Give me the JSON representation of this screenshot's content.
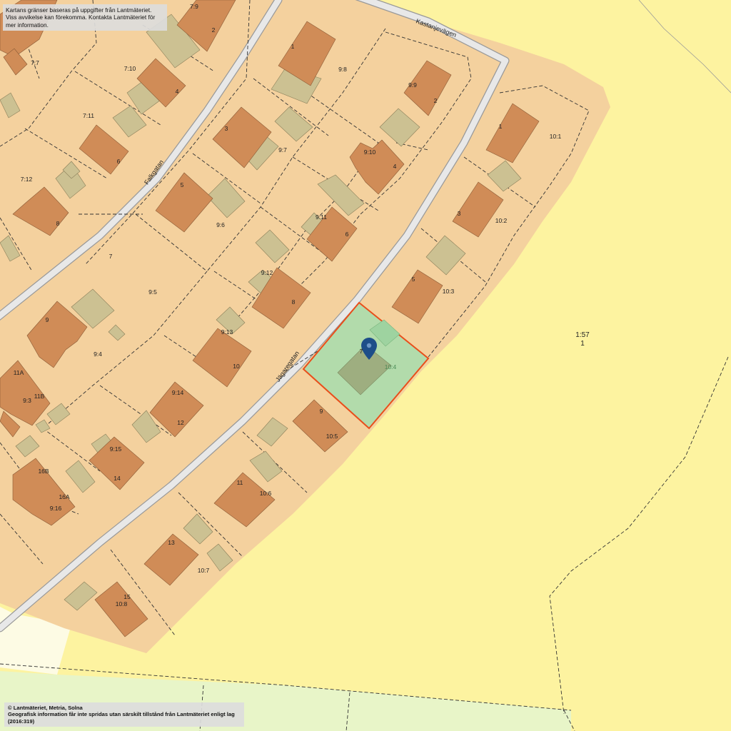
{
  "notices": {
    "top_line1": "Kartans gränser baseras på uppgifter från Lantmäteriet.",
    "top_line2": "Viss avvikelse kan förekomma. Kontakta Lantmäteriet för mer information.",
    "bottom_line1": "© Lantmäteriet, Metria, Solna",
    "bottom_line2": "Geografisk information får inte spridas utan särskilt tillstånd från Lantmäteriet enligt lag (2016:319)"
  },
  "streets": {
    "falkgatan": "Falkgatan",
    "jagaregatan": "Jägaregatan",
    "kastanjevagen": "Kastanjevägen"
  },
  "property_labels": [
    "7:9",
    "7:7",
    "7:10",
    "7:11",
    "7:12",
    "7",
    "9:8",
    "9:9",
    "9:7",
    "9:10",
    "9:6",
    "9:11",
    "9:5",
    "9:12",
    "9:4",
    "9:13",
    "9:14",
    "9:3",
    "9:15",
    "9:16",
    "10:1",
    "10:2",
    "10:3",
    "10:4",
    "10:5",
    "10:6",
    "10:7",
    "10:8",
    "1:57"
  ],
  "house_numbers": [
    "2",
    "4",
    "6",
    "8",
    "1",
    "2",
    "3",
    "4",
    "5",
    "6",
    "8",
    "9",
    "10",
    "12",
    "14",
    "11A",
    "11B",
    "16B",
    "16A",
    "1",
    "3",
    "5",
    "7",
    "9",
    "11",
    "13",
    "15",
    "1"
  ],
  "selected_property": {
    "label": "10:4",
    "house_number": "7"
  },
  "colors": {
    "residential_area": "#f4d19e",
    "open_land": "#fdf3a0",
    "building": "#d08c57",
    "outbuilding": "#ccc192",
    "road": "#e8e8e8",
    "selected_fill": "#b2dbab",
    "selected_border": "#e94e1b",
    "marker": "#1d4e89",
    "green_land": "#e8f5c8"
  },
  "icons": {
    "marker": "map-pin-icon"
  }
}
